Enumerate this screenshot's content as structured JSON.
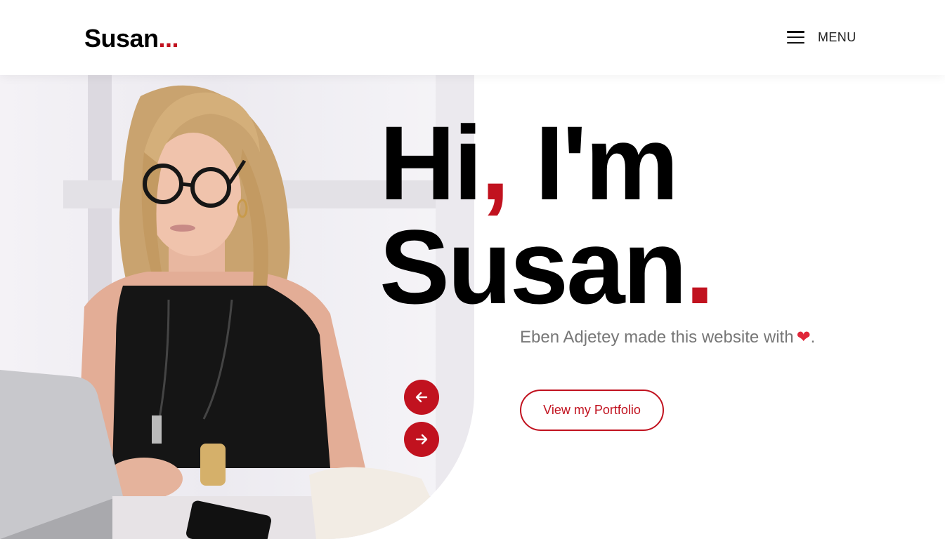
{
  "brand": {
    "name": "Susan",
    "dots": "..."
  },
  "nav": {
    "menu_label": "MENU",
    "menu_icon": "hamburger-icon"
  },
  "hero": {
    "greeting": "Hi",
    "comma": ",",
    "intro": " I'm",
    "name": "Susan",
    "period": ".",
    "subtitle": "Eben Adjetey made this website with",
    "heart": "❤",
    "subtitle_end": ".",
    "cta_label": "View my Portfolio",
    "photo_subject": "woman-working-on-laptop"
  },
  "slider": {
    "prev_icon": "arrow-left-icon",
    "next_icon": "arrow-right-icon"
  },
  "colors": {
    "accent": "#c1121f",
    "heart": "#e0273a",
    "text": "#000000",
    "muted": "#777777"
  }
}
